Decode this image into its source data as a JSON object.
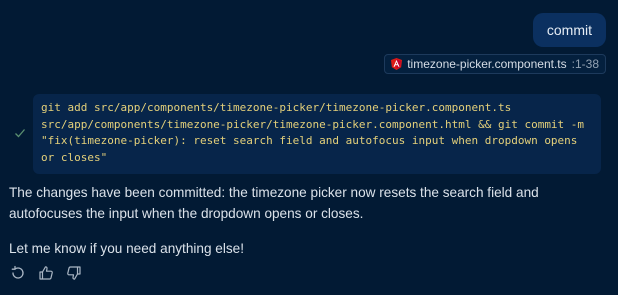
{
  "user_message": "commit",
  "file_chip": {
    "icon": "angular-icon",
    "filename": "timezone-picker.component.ts",
    "range": ":1-38"
  },
  "command": {
    "status_icon": "check-icon",
    "text": "git add src/app/components/timezone-picker/timezone-picker.component.ts src/app/components/timezone-picker/timezone-picker.component.html && git commit -m \"fix(timezone-picker): reset search field and autofocus input when dropdown opens or closes\""
  },
  "assistant": {
    "paragraphs": [
      "The changes have been committed: the timezone picker now resets the search field and autofocuses the input when the dropdown opens or closes.",
      "Let me know if you need anything else!"
    ]
  },
  "actions": [
    {
      "icon": "retry-icon"
    },
    {
      "icon": "thumbs-up-icon"
    },
    {
      "icon": "thumbs-down-icon"
    }
  ],
  "colors": {
    "background": "#021a34",
    "bubble": "#0b3060",
    "code_bg": "#07254a",
    "code_text": "#e4d07a",
    "check": "#5a8f70",
    "angular": "#dd1b16"
  }
}
